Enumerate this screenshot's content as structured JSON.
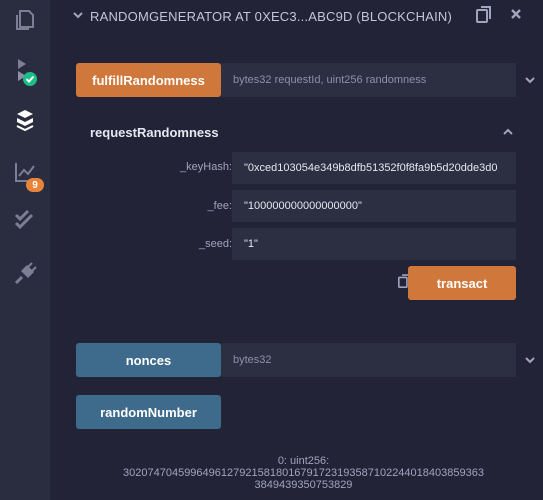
{
  "panel_header": {
    "title": "RANDOMGENERATOR AT 0XEC3...ABC9D (BLOCKCHAIN)"
  },
  "sidebar": {
    "icons": [
      "file-explorer-icon",
      "compiler-icon",
      "deploy-run-icon",
      "analysis-icon",
      "test-icon",
      "plugin-icon"
    ],
    "analysis_badge": "9"
  },
  "functions": {
    "fulfill": {
      "label": "fulfillRandomness",
      "params": "bytes32 requestId, uint256 randomness"
    },
    "request": {
      "label": "requestRandomness",
      "fields": [
        {
          "label": "_keyHash:",
          "value": "\"0xced103054e349b8dfb51352f0f8fa9b5d20dde3d0"
        },
        {
          "label": "_fee:",
          "value": "\"100000000000000000\""
        },
        {
          "label": "_seed:",
          "value": "\"1\""
        }
      ],
      "transact_label": "transact"
    },
    "nonces": {
      "label": "nonces",
      "params": "bytes32"
    },
    "randomNumber": {
      "label": "randomNumber"
    }
  },
  "output": {
    "line1": "0: uint256:",
    "line2": "30207470459964961279215818016791723193587102244018403859363",
    "line3": "3849439350753829"
  },
  "colors": {
    "accent_orange": "#d0773b",
    "call_blue": "#3e6a8c",
    "badge_orange": "#e8833a",
    "success_green": "#1cbe88"
  }
}
